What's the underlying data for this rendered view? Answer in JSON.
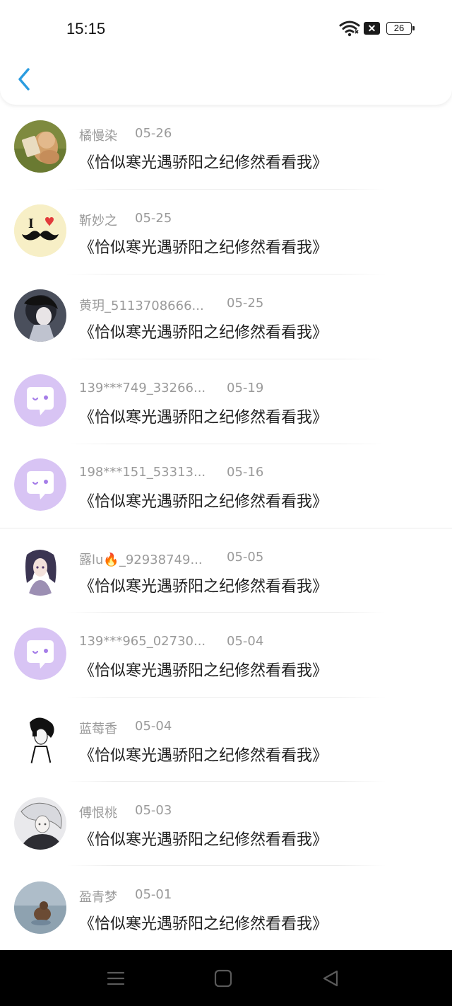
{
  "status_bar": {
    "time": "15:15",
    "battery": "26",
    "sim_icon": "sim-error-icon",
    "wifi_icon": "wifi-icon"
  },
  "header": {
    "back_icon": "chevron-left-icon"
  },
  "conversations": [
    {
      "name": "橘慢染",
      "date": "05-26",
      "message": "《恰似寒光遇骄阳之纪修然看看我》",
      "avatar": "photo-girl-field"
    },
    {
      "name": "靳妙之",
      "date": "05-25",
      "message": "《恰似寒光遇骄阳之纪修然看看我》",
      "avatar": "i-love-mustache",
      "avatar_text": "I"
    },
    {
      "name": "黄玥_5113708666...",
      "date": "05-25",
      "message": "《恰似寒光遇骄阳之纪修然看看我》",
      "avatar": "anime-dark"
    },
    {
      "name": "139***749_33266...",
      "date": "05-19",
      "message": "《恰似寒光遇骄阳之纪修然看看我》",
      "avatar": "default-chat"
    },
    {
      "name": "198***151_53313...",
      "date": "05-16",
      "message": "《恰似寒光遇骄阳之纪修然看看我》",
      "avatar": "default-chat"
    },
    {
      "name": "露lu🔥_92938749...",
      "date": "05-05",
      "message": "《恰似寒光遇骄阳之纪修然看看我》",
      "avatar": "anime-girl"
    },
    {
      "name": "139***965_02730...",
      "date": "05-04",
      "message": "《恰似寒光遇骄阳之纪修然看看我》",
      "avatar": "default-chat"
    },
    {
      "name": "蓝莓香",
      "date": "05-04",
      "message": "《恰似寒光遇骄阳之纪修然看看我》",
      "avatar": "sketch-boy"
    },
    {
      "name": "傅恨桃",
      "date": "05-03",
      "message": "《恰似寒光遇骄阳之纪修然看看我》",
      "avatar": "anime-silver"
    },
    {
      "name": "盈青梦",
      "date": "05-01",
      "message": "《恰似寒光遇骄阳之纪修然看看我》",
      "avatar": "photo-dog-sea"
    }
  ],
  "navbar": {
    "menu_icon": "menu-icon",
    "home_icon": "home-square-icon",
    "back_icon": "back-triangle-icon"
  },
  "colors": {
    "accent": "#2b9ce0",
    "default_avatar_bg": "#d8c4f4",
    "default_avatar_fg": "#a57de8"
  }
}
